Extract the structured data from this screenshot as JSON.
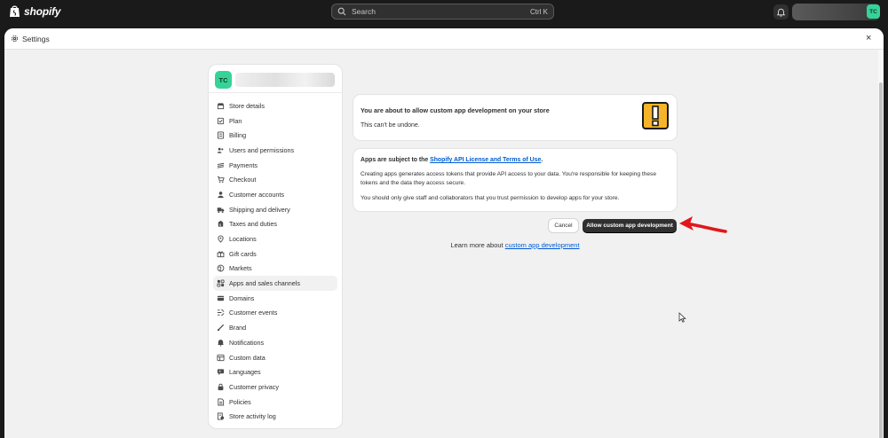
{
  "topbar": {
    "logo_text": "shopify",
    "search_placeholder": "Search",
    "search_shortcut": "Ctrl K",
    "avatar_initials": "TC",
    "accent_color": "#36d399"
  },
  "settings": {
    "title": "Settings",
    "close_symbol": "×"
  },
  "store": {
    "initials": "TC"
  },
  "nav": {
    "items": [
      {
        "label": "Store details",
        "icon": "store-icon"
      },
      {
        "label": "Plan",
        "icon": "plan-icon"
      },
      {
        "label": "Billing",
        "icon": "billing-icon"
      },
      {
        "label": "Users and permissions",
        "icon": "users-icon"
      },
      {
        "label": "Payments",
        "icon": "payments-icon"
      },
      {
        "label": "Checkout",
        "icon": "checkout-icon"
      },
      {
        "label": "Customer accounts",
        "icon": "customer-icon"
      },
      {
        "label": "Shipping and delivery",
        "icon": "truck-icon"
      },
      {
        "label": "Taxes and duties",
        "icon": "taxes-icon"
      },
      {
        "label": "Locations",
        "icon": "location-icon"
      },
      {
        "label": "Gift cards",
        "icon": "gift-icon"
      },
      {
        "label": "Markets",
        "icon": "globe-icon"
      },
      {
        "label": "Apps and sales channels",
        "icon": "apps-icon",
        "active": true
      },
      {
        "label": "Domains",
        "icon": "domains-icon"
      },
      {
        "label": "Customer events",
        "icon": "events-icon"
      },
      {
        "label": "Brand",
        "icon": "brand-icon"
      },
      {
        "label": "Notifications",
        "icon": "bell-icon"
      },
      {
        "label": "Custom data",
        "icon": "data-icon"
      },
      {
        "label": "Languages",
        "icon": "languages-icon"
      },
      {
        "label": "Customer privacy",
        "icon": "lock-icon"
      },
      {
        "label": "Policies",
        "icon": "policies-icon"
      },
      {
        "label": "Store activity log",
        "icon": "log-icon"
      }
    ]
  },
  "warning_card": {
    "heading": "You are about to allow custom app development on your store",
    "subtext": "This can't be undone."
  },
  "terms_card": {
    "heading_prefix": "Apps are subject to the ",
    "heading_link": "Shopify API License and Terms of Use",
    "heading_suffix": ".",
    "paragraph1": "Creating apps generates access tokens that provide API access to your data. You're responsible for keeping these tokens and the data they access secure.",
    "paragraph2": "You should only give staff and collaborators that you trust permission to develop apps for your store."
  },
  "actions": {
    "cancel_label": "Cancel",
    "allow_label": "Allow custom app development"
  },
  "learn_more": {
    "prefix": "Learn more about ",
    "link": "custom app development"
  }
}
